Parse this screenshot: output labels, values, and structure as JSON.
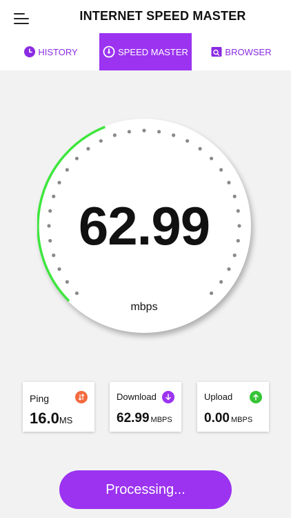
{
  "header": {
    "title": "INTERNET SPEED MASTER",
    "menu_icon": "hamburger-menu-icon"
  },
  "tabs": [
    {
      "label": "HISTORY",
      "icon": "clock-icon",
      "active": false
    },
    {
      "label": "SPEED MASTER",
      "icon": "speedometer-icon",
      "active": true
    },
    {
      "label": "BROWSER",
      "icon": "browser-search-icon",
      "active": false
    }
  ],
  "gauge": {
    "value": "62.99",
    "unit": "mbps",
    "progress_fraction": 0.42,
    "progress_color": "#3ee63e",
    "tick_color": "#8a8a8a"
  },
  "stats": {
    "ping": {
      "label": "Ping",
      "value": "16.0",
      "unit": "MS",
      "icon": "ping-icon",
      "icon_color": "#f26a3d"
    },
    "download": {
      "label": "Download",
      "value": "62.99",
      "unit": "MBPS",
      "icon": "download-arrow-icon",
      "icon_color": "#9b33f0"
    },
    "upload": {
      "label": "Upload",
      "value": "0.00",
      "unit": "MBPS",
      "icon": "upload-arrow-icon",
      "icon_color": "#35c435"
    }
  },
  "action": {
    "label": "Processing..."
  },
  "colors": {
    "accent": "#9b33f0",
    "progress": "#3ee63e"
  }
}
